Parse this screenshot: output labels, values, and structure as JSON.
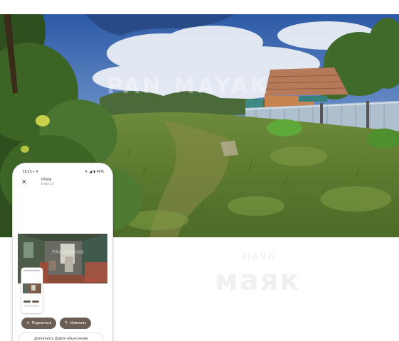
{
  "photo": {
    "watermark": "PAN MAYAK"
  },
  "background_logo": {
    "text": "маяк",
    "sub": "МАЯК"
  },
  "phone": {
    "status": {
      "time": "16:15",
      "battery": "42%"
    },
    "header": {
      "close": "✕",
      "title": "Обзор",
      "subtitle": "9 Окт 17"
    },
    "inner_photo": {
      "watermark": "PAN MAYAK"
    },
    "buttons": {
      "share_label": "Поделиться",
      "edit_label": "Изменить"
    },
    "bottom_bar": {
      "text": "Дополнить Дайте обьяснение"
    }
  },
  "colors": {
    "button_fill": "#6b5e55",
    "sky": "#3d6bb0",
    "grass": "#5c7a33"
  }
}
